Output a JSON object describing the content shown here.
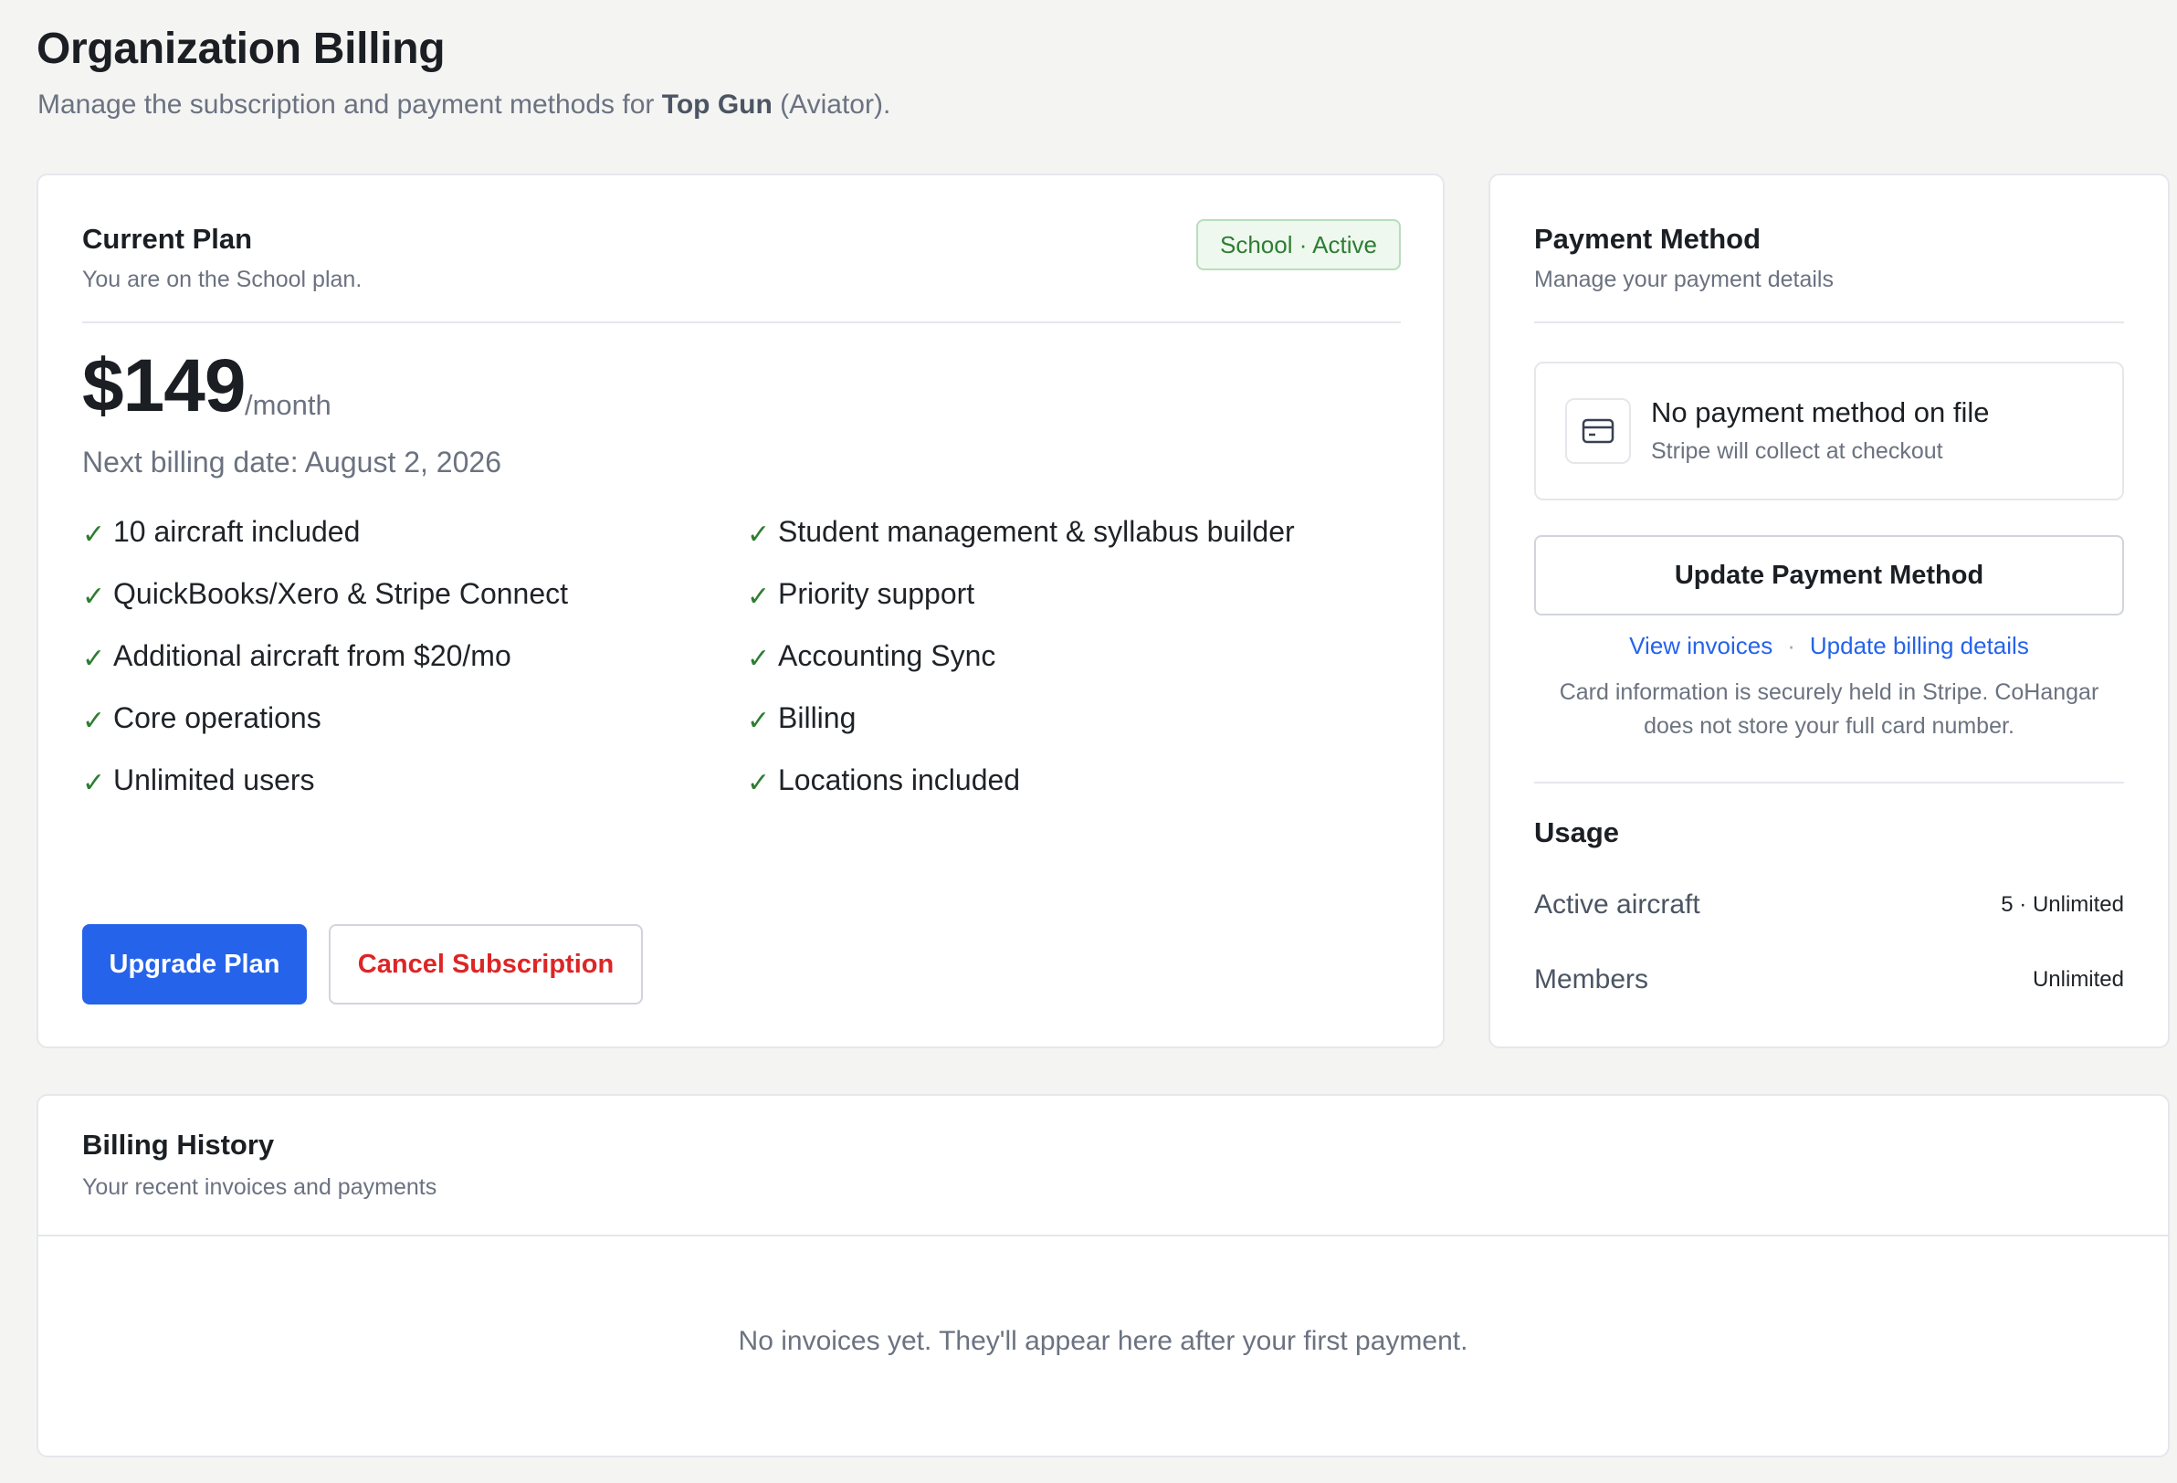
{
  "header": {
    "title": "Organization Billing",
    "subtitle_prefix": "Manage the subscription and payment methods for ",
    "org_name": "Top Gun",
    "subtitle_suffix": " (Aviator)."
  },
  "plan": {
    "title": "Current Plan",
    "subtitle": "You are on the School plan.",
    "badge": "School · Active",
    "price": "$149",
    "period": "/month",
    "next_billing": "Next billing date: August 2, 2026",
    "features_left": [
      "10 aircraft included",
      "QuickBooks/Xero & Stripe Connect",
      "Additional aircraft from $20/mo",
      "Core operations",
      "Unlimited users"
    ],
    "features_right": [
      "Student management & syllabus builder",
      "Priority support",
      "Accounting Sync",
      "Billing",
      "Locations included"
    ],
    "check_glyph": "✓",
    "upgrade_label": "Upgrade Plan",
    "cancel_label": "Cancel Subscription"
  },
  "payment": {
    "title": "Payment Method",
    "subtitle": "Manage your payment details",
    "no_method_title": "No payment method on file",
    "no_method_sub": "Stripe will collect at checkout",
    "card_icon": "credit-card-icon",
    "update_label": "Update Payment Method",
    "view_invoices": "View invoices",
    "link_separator": "·",
    "update_billing": "Update billing details",
    "secure_note": "Card information is securely held in Stripe. CoHangar does not store your full card number."
  },
  "usage": {
    "title": "Usage",
    "rows": [
      {
        "label": "Active aircraft",
        "value": "5 · Unlimited"
      },
      {
        "label": "Members",
        "value": "Unlimited"
      }
    ]
  },
  "history": {
    "title": "Billing History",
    "subtitle": "Your recent invoices and payments",
    "empty": "No invoices yet. They'll appear here after your first payment."
  },
  "colors": {
    "primary": "#2563eb",
    "danger": "#dc2626",
    "success": "#2e7d32",
    "background": "#f4f4f3"
  }
}
